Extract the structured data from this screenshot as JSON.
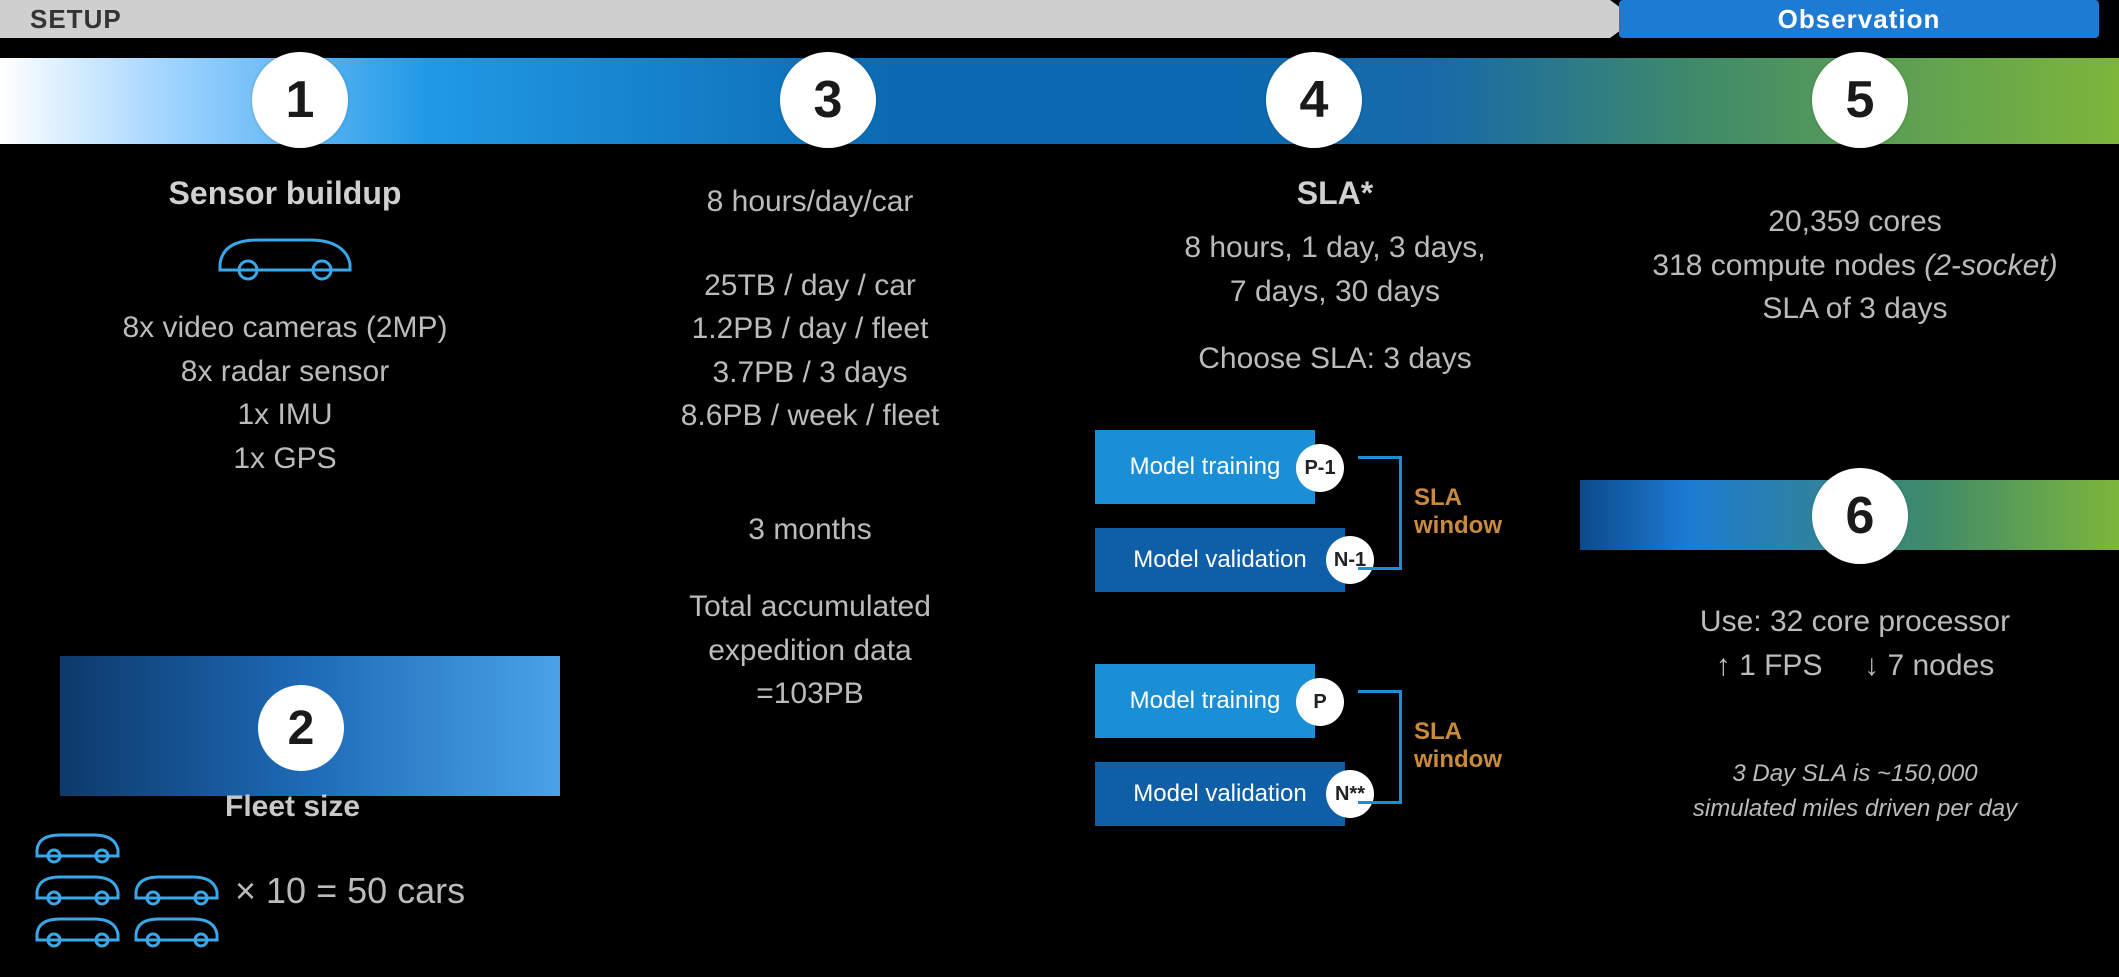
{
  "header": {
    "setup": "SETUP",
    "observation": "Observation"
  },
  "steps": {
    "s1": "1",
    "s2": "2",
    "s3": "3",
    "s4": "4",
    "s5": "5",
    "s6": "6"
  },
  "col1": {
    "title": "Sensor buildup",
    "l1": "8x video cameras (2MP)",
    "l2": "8x radar sensor",
    "l3": "1x IMU",
    "l4": "1x GPS"
  },
  "col2": {
    "title": "Fleet size",
    "mult": "× 10 = 50 cars"
  },
  "col3": {
    "l1": "8 hours/day/car",
    "d1": "25TB / day / car",
    "d2": "1.2PB / day / fleet",
    "d3": "3.7PB / 3 days",
    "d4": "8.6PB / week / fleet",
    "dur": "3 months",
    "t1": "Total accumulated",
    "t2": "expedition data",
    "t3": "=103PB"
  },
  "col4": {
    "title": "SLA*",
    "opts1": "8 hours, 1 day, 3 days,",
    "opts2": "7 days, 30 days",
    "choose": "Choose SLA: 3 days",
    "box_train": "Model training",
    "box_val": "Model validation",
    "tag_p1": "P-1",
    "tag_n1": "N-1",
    "tag_p": "P",
    "tag_n": "N**",
    "sla_window": "SLA window"
  },
  "col5": {
    "l1": "20,359 cores",
    "l2a": "318 compute nodes ",
    "l2b": "(2-socket)",
    "l3": "SLA of 3 days"
  },
  "col6": {
    "l1": "Use: 32 core processor",
    "up": "↑ 1 FPS",
    "dn": "↓ 7 nodes",
    "note1": "3 Day SLA is ~150,000",
    "note2": "simulated miles driven per day"
  }
}
